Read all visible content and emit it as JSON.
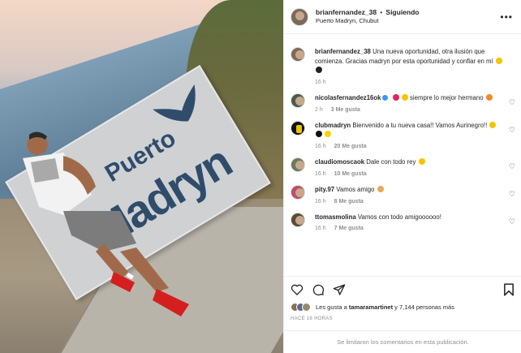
{
  "post": {
    "username": "brianfernandez_38",
    "follow_label": "Siguiendo",
    "location": "Puerto Madryn, Chubut",
    "photo_sign_line1": "Puerto",
    "photo_sign_line2": "Madryn",
    "caption_user": "brianfernandez_38",
    "caption_text": "Una nueva oportunidad, otra ilusión que comienza. Gracias madryn por esta oportunidad y confiar en mí",
    "caption_time": "16 h"
  },
  "comments": [
    {
      "user": "nicolasfernandez16ok",
      "verified": true,
      "text": "siempre lo mejor hermano",
      "time": "2 h",
      "likes": "3 Me gusta"
    },
    {
      "user": "clubmadryn",
      "verified": false,
      "text": "Bienvenido a tu nueva casa!! Vamos Aurinegro!!",
      "time": "16 h",
      "likes": "20 Me gusta"
    },
    {
      "user": "claudiomoscaok",
      "verified": false,
      "text": "Dale con todo rey",
      "time": "16 h",
      "likes": "10 Me gusta"
    },
    {
      "user": "pity.97",
      "verified": false,
      "text": "Vamos amigo",
      "time": "16 h",
      "likes": "8 Me gusta"
    },
    {
      "user": "ttomasmolina",
      "verified": false,
      "text": "Vamos con todo amigoooooo!",
      "time": "16 h",
      "likes": "7 Me gusta"
    }
  ],
  "actions": {
    "likes_prefix": "Les gusta a",
    "likes_user": "tamaramartinet",
    "likes_rest": "y 7,144 personas más",
    "when": "HACE 16 HORAS",
    "comments_limited": "Se limitaron los comentarios en esta publicación."
  },
  "icons": [
    "heart-icon",
    "comment-icon",
    "share-icon",
    "bookmark-icon",
    "more-icon"
  ]
}
